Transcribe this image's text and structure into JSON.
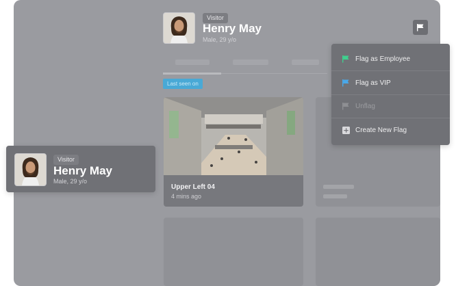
{
  "profile": {
    "badge": "Visitor",
    "name": "Henry May",
    "details": "Male, 29 y/o"
  },
  "last_seen_label": "Last seen on",
  "camera_card": {
    "title": "Upper Left 04",
    "time": "4 mins ago"
  },
  "flag_menu": {
    "items": [
      {
        "label": "Flag as Employee",
        "icon": "flag-icon",
        "color": "#3fcf8e",
        "enabled": true
      },
      {
        "label": "Flag as VIP",
        "icon": "flag-icon",
        "color": "#4aa8e8",
        "enabled": true
      },
      {
        "label": "Unflag",
        "icon": "flag-icon",
        "color": "#8e8f93",
        "enabled": false
      },
      {
        "label": "Create New Flag",
        "icon": "plus-square-icon",
        "color": "#d9d9dc",
        "enabled": true
      }
    ]
  },
  "overlay_card": {
    "badge": "Visitor",
    "name": "Henry May",
    "details": "Male, 29 y/o"
  },
  "colors": {
    "panel": "#9a9ba0",
    "menu_bg": "#707176",
    "last_seen_bg": "#49a9d6"
  }
}
